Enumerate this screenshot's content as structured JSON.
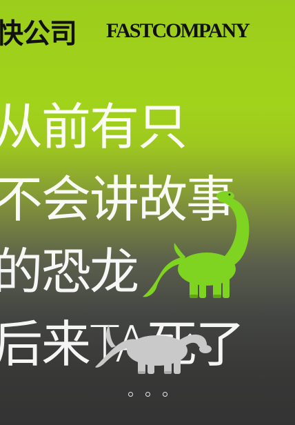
{
  "header": {
    "brand_cn": "快公司",
    "brand_en": "FASTCOMPANY"
  },
  "poem": {
    "lines": [
      "从前有只",
      "不会讲故事",
      "的恐龙",
      "后来TA死了"
    ]
  },
  "colors": {
    "accent_green": "#9ccd1c",
    "dino_green": "#7fd321",
    "dino_gray": "#c9c9c9"
  },
  "pagination": {
    "count": 3
  }
}
